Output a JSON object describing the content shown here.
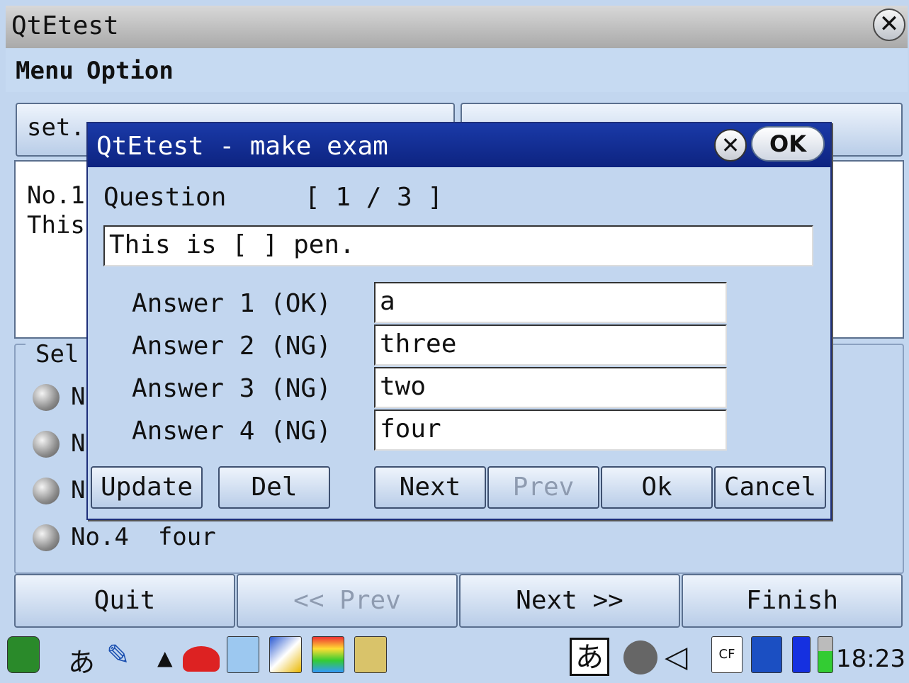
{
  "window": {
    "title": "QtEtest",
    "close_icon": "close-icon"
  },
  "menubar": {
    "items": [
      "Menu",
      "Option"
    ]
  },
  "background": {
    "set_button": "set.",
    "text_lines": [
      "No.1",
      "This"
    ],
    "group_title": "Sel",
    "radio_items": [
      {
        "label": "N"
      },
      {
        "label": "N"
      },
      {
        "label": "N"
      },
      {
        "label": "No.4  four"
      }
    ]
  },
  "nav": {
    "quit": "Quit",
    "prev": "<< Prev",
    "next": "Next >>",
    "finish": "Finish"
  },
  "dialog": {
    "title": "QtEtest - make exam",
    "ok_label": "OK",
    "question_label": "Question",
    "counter": "[ 1 / 3 ]",
    "question_text": "This is [ ] pen.",
    "answers": [
      {
        "label": "Answer 1 (OK)",
        "value": "a"
      },
      {
        "label": "Answer 2 (NG)",
        "value": "three"
      },
      {
        "label": "Answer 3 (NG)",
        "value": "two"
      },
      {
        "label": "Answer 4 (NG)",
        "value": "four"
      }
    ],
    "buttons": {
      "update": "Update",
      "del": "Del",
      "next": "Next",
      "prev": "Prev",
      "ok": "Ok",
      "cancel": "Cancel"
    }
  },
  "taskbar": {
    "ime_label": "あ",
    "ime_box": "あ",
    "clock": "18:23",
    "icons": [
      "qtopia-start-icon",
      "pen-icon",
      "up-arrow-icon",
      "cap-icon",
      "calendar-icon",
      "note-icon",
      "palette-icon",
      "book-icon",
      "ime-icon",
      "network-off-icon",
      "speaker-icon",
      "cf-card-icon",
      "sd-card-icon",
      "battery-icon",
      "signal-icon"
    ]
  }
}
